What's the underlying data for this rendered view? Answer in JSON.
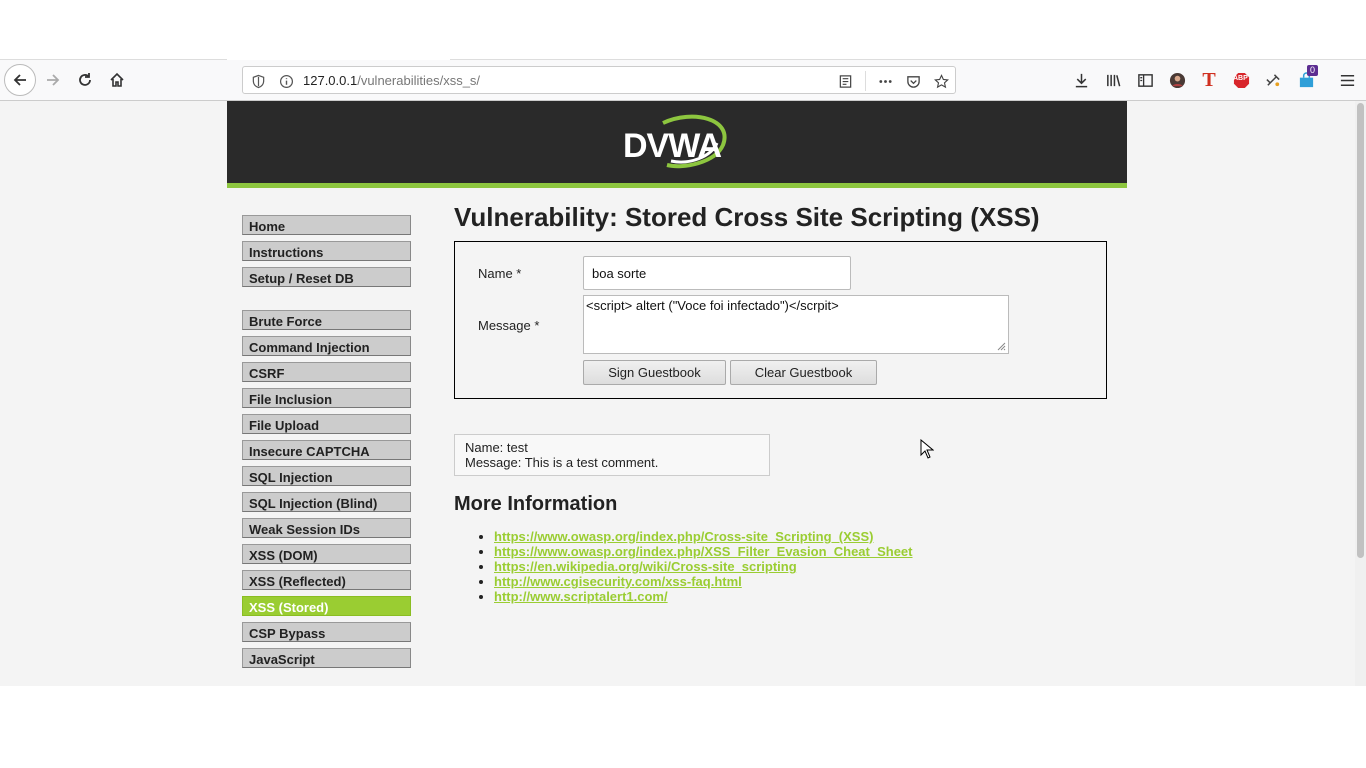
{
  "browser": {
    "url_host": "127.0.0.1",
    "url_path": "/vulnerabilities/xss_s/",
    "icons": {
      "back": "back-arrow-icon",
      "forward": "forward-arrow-icon",
      "reload": "reload-icon",
      "home": "home-icon",
      "shield": "shield-icon",
      "info": "info-icon",
      "reader": "reader-view-icon",
      "more": "more-dots-icon",
      "pocket": "pocket-icon",
      "bookmark": "star-icon",
      "download": "download-icon",
      "library": "library-icon",
      "sidebar": "sidebar-icon",
      "account": "account-avatar-icon",
      "extension_t": "extension-t-icon",
      "abp": "adblock-icon",
      "ext_tool": "extension-tool-icon",
      "ext_badge": "extension-badge-icon",
      "menu": "hamburger-menu-icon"
    },
    "badge_count": "0",
    "abp_label": "ABP",
    "t_label": "T"
  },
  "site": {
    "logo_text": "DVWA",
    "accent_color": "#9acd32",
    "header_color": "#2a2a2a"
  },
  "menu": {
    "group1": [
      "Home",
      "Instructions",
      "Setup / Reset DB"
    ],
    "group2": [
      "Brute Force",
      "Command Injection",
      "CSRF",
      "File Inclusion",
      "File Upload",
      "Insecure CAPTCHA",
      "SQL Injection",
      "SQL Injection (Blind)",
      "Weak Session IDs",
      "XSS (DOM)",
      "XSS (Reflected)",
      "XSS (Stored)",
      "CSP Bypass",
      "JavaScript"
    ],
    "selected": "XSS (Stored)"
  },
  "page": {
    "title": "Vulnerability: Stored Cross Site Scripting (XSS)",
    "form": {
      "name_label": "Name *",
      "name_value": "boa sorte",
      "message_label": "Message *",
      "message_value": "<script> altert (\"Voce foi infectado\")</scrpit>",
      "sign_button": "Sign Guestbook",
      "clear_button": "Clear Guestbook"
    },
    "entry": {
      "name_line": "Name: test",
      "message_line": "Message: This is a test comment."
    },
    "more_info_heading": "More Information",
    "links": [
      "https://www.owasp.org/index.php/Cross-site_Scripting_(XSS)",
      "https://www.owasp.org/index.php/XSS_Filter_Evasion_Cheat_Sheet",
      "https://en.wikipedia.org/wiki/Cross-site_scripting",
      "http://www.cgisecurity.com/xss-faq.html",
      "http://www.scriptalert1.com/"
    ]
  }
}
